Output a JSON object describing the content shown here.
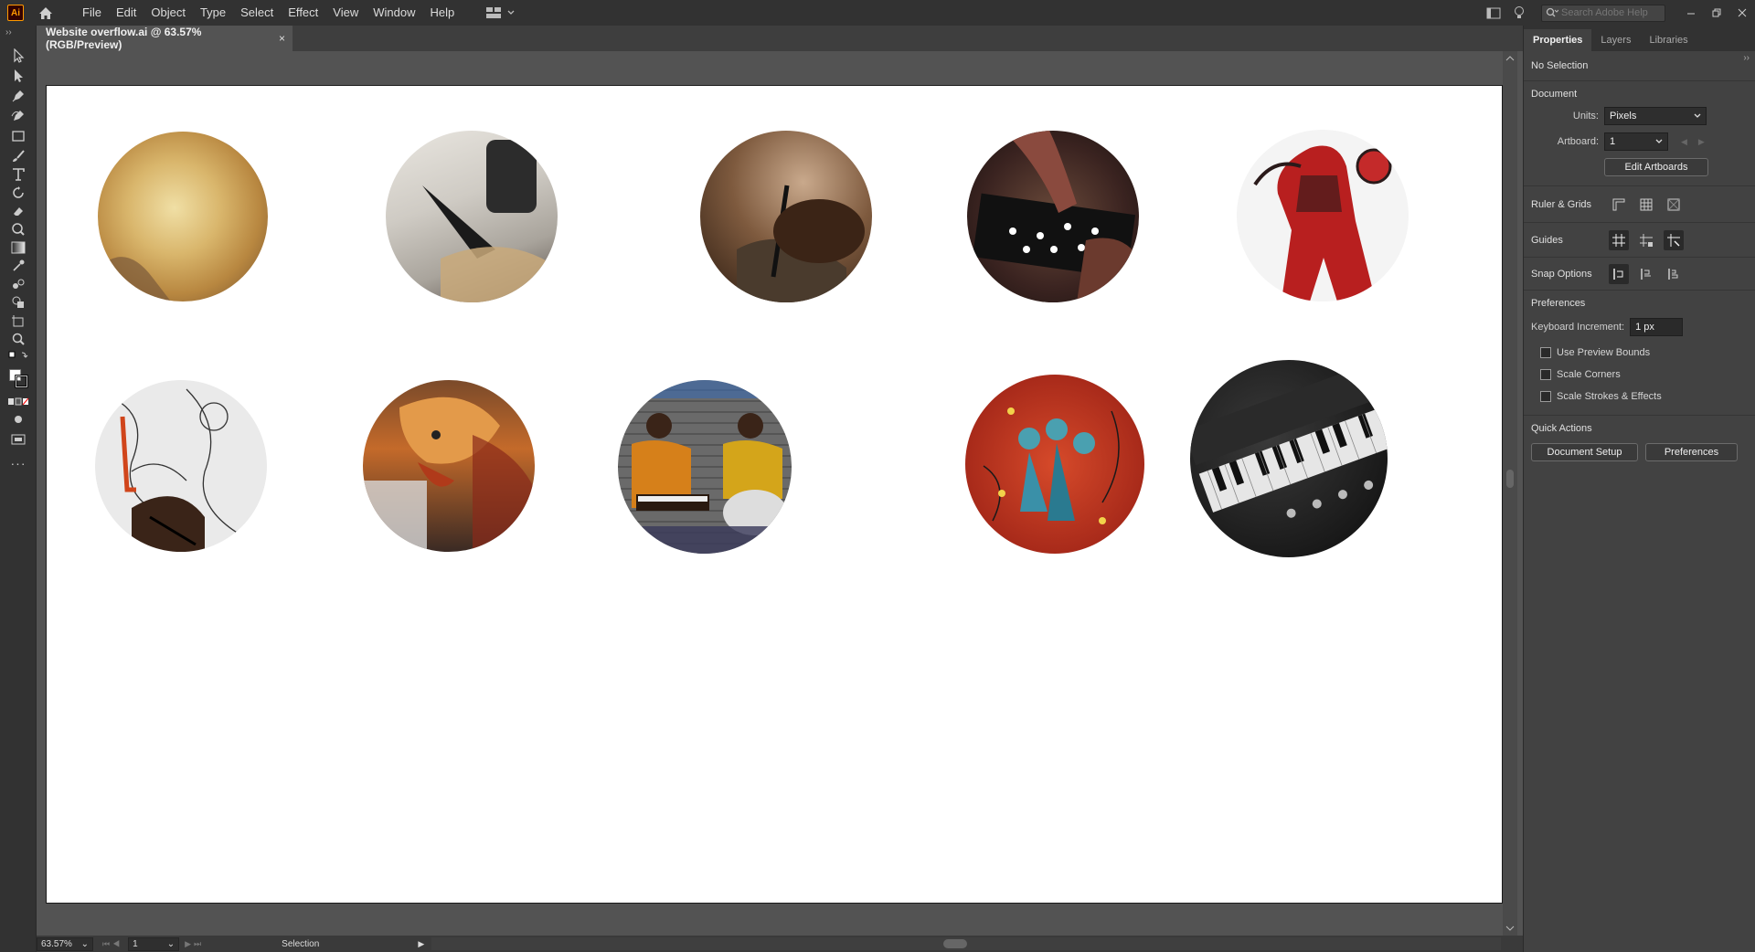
{
  "app": {
    "logo_text": "Ai",
    "menus": [
      "File",
      "Edit",
      "Object",
      "Type",
      "Select",
      "Effect",
      "View",
      "Window",
      "Help"
    ]
  },
  "search": {
    "placeholder": "Search Adobe Help"
  },
  "document_tab": {
    "title": "Website overflow.ai @ 63.57% (RGB/Preview)",
    "close": "×"
  },
  "status_bar": {
    "zoom": "63.57%",
    "artboard": "1",
    "tool": "Selection"
  },
  "panel": {
    "tabs": [
      "Properties",
      "Layers",
      "Libraries"
    ],
    "selection": "No Selection",
    "document_title": "Document",
    "units_label": "Units:",
    "units_value": "Pixels",
    "artboard_label": "Artboard:",
    "artboard_value": "1",
    "edit_artboards": "Edit Artboards",
    "ruler_grids": "Ruler & Grids",
    "guides": "Guides",
    "snap_options": "Snap Options",
    "preferences_title": "Preferences",
    "keyboard_increment_label": "Keyboard Increment:",
    "keyboard_increment_value": "1 px",
    "checkboxes": [
      "Use Preview Bounds",
      "Scale Corners",
      "Scale Strokes & Effects"
    ],
    "quick_actions": "Quick Actions",
    "document_setup": "Document Setup",
    "preferences_button": "Preferences"
  },
  "colors": {
    "ui_dark": "#323232",
    "ui_mid": "#424242",
    "canvas_bg": "#535353",
    "artboard": "#ffffff"
  }
}
